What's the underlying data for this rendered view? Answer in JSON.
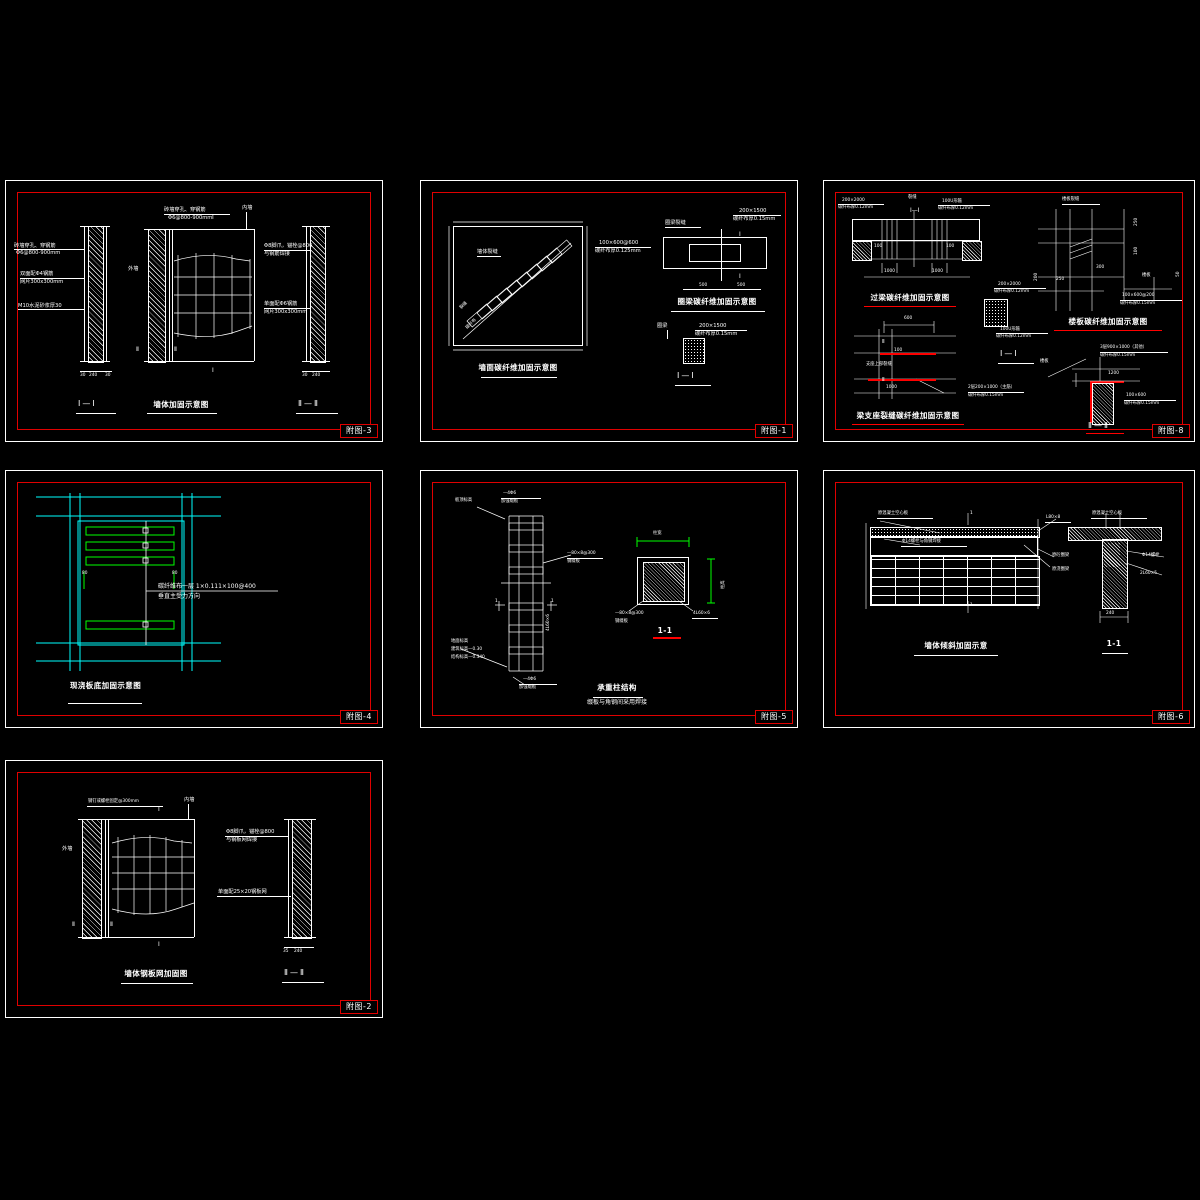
{
  "drawing": {
    "background": "#000000",
    "line_color": "#ffffff",
    "frame_color": "#ff0000",
    "accent_cyan": "#00ffff",
    "accent_green": "#00ff00"
  },
  "sheets": [
    {
      "id": "fig3",
      "title_block": "附图-3",
      "main_title": "墙体加固示意图",
      "labels": {
        "note_top_1": "砖墙穿孔、穿钢筋",
        "note_top_2": "Φ6@800-900mm",
        "left_note_1": "砖墙穿孔、穿钢筋",
        "left_note_2": "Φ6@800-900mm",
        "left_note_3": "双面配Φ4钢筋",
        "left_note_4": "网片300x300mm",
        "left_note_5": "M10水泥砂浆厚30",
        "right_note_1": "Φ8脚爪，锚栓@800",
        "right_note_2": "与钢筋焊接",
        "right_note_3": "单面配Φ6钢筋",
        "right_note_4": "网片300x300mm",
        "outer_wall": "外墙",
        "inner_wall": "内墙",
        "dim_left": "30",
        "dim_mid": "240",
        "dim_right": "30",
        "dim2_left": "30",
        "dim2_mid": "240",
        "section_1": "Ⅰ—Ⅰ",
        "section_2": "Ⅱ—Ⅱ",
        "mark_I": "Ⅰ",
        "mark_II": "Ⅱ"
      }
    },
    {
      "id": "fig1",
      "title_block": "附图-1",
      "main_title": "墙面碳纤维加固示意图",
      "sub_title": "圈梁碳纤维加固示意图",
      "labels": {
        "wall_crack": "墙体裂缝",
        "spec_1": "100×600@600",
        "spec_2": "碳纤布厚0.125mm",
        "ring_crack": "圈梁裂缝",
        "spec_3": "200×1500",
        "spec_4": "碳纤布厚0.15mm",
        "dim_500_a": "500",
        "dim_500_b": "500",
        "ring_beam": "圈梁",
        "spec_5": "200×1500",
        "spec_6": "碳纤布厚0.15mm",
        "section_1": "Ⅰ—Ⅰ",
        "mark_I": "Ⅰ",
        "crack_label_a": "裂缝",
        "crack_label_b": "碳纤布"
      }
    },
    {
      "id": "fig8",
      "title_block": "附图-8",
      "titles": {
        "t1": "过梁碳纤维加固示意图",
        "t2": "梁支座裂缝碳纤维加固示意图",
        "t3": "楼板碳纤维加固示意图",
        "sec_11": "Ⅰ—Ⅰ",
        "sec_22": "Ⅱ—Ⅱ"
      },
      "labels": {
        "a1": "200×2000",
        "a2": "碳纤布厚0.12mm",
        "a3": "裂缝",
        "a4": "100U形箍",
        "a5": "碳纤布厚0.12mm",
        "a6": "100",
        "a7": "100",
        "a8": "1000",
        "a9": "1000",
        "b1": "200×2000",
        "b2": "碳纤布厚0.12mm",
        "b3": "100U形箍",
        "b4": "碳纤布厚0.12mm",
        "c1": "600",
        "c2": "100",
        "c3": "支座上部裂缝",
        "c4": "1000",
        "c5": "2层200×1000（主筋）",
        "c6": "碳纤布厚0.15mm",
        "d1": "楼板裂缝",
        "d2": "250",
        "d3": "100",
        "d4": "200",
        "d5": "250",
        "d6": "300",
        "d7": "楼板",
        "d8": "50",
        "d9": "100×600@200",
        "d10": "碳纤布厚0.15mm",
        "e1": "楼板",
        "e2": "3层900×1000（其他）",
        "e3": "碳纤布厚0.15mm",
        "e4": "1200",
        "e5": "100×600",
        "e6": "碳纤布厚0.15mm"
      }
    },
    {
      "id": "fig4",
      "title_block": "附图-4",
      "main_title": "现浇板底加固示意图",
      "labels": {
        "note_1": "碳纤维布一层  1×0.111×100@400",
        "note_2": "垂直主受力方向",
        "dim_a": "80",
        "dim_b": "80"
      }
    },
    {
      "id": "fig5",
      "title_block": "附图-5",
      "main_title": "承重柱结构",
      "sub_title": "缀板与角钢间采用焊接",
      "section": "1-1",
      "labels": {
        "top_1": "板顶标高",
        "top_2": "—4Φ6",
        "top_3": "加强缀板",
        "mid_1": "—80×8@300",
        "mid_2": "钢缀板",
        "mid_3": "4L60×6",
        "bot_1": "地面标高",
        "bot_2": "建筑标高—0.30",
        "bot_3": "结构标高—0.340",
        "bot_4": "—4Φ6",
        "bot_5": "加强缀板",
        "sec_1": "柱宽",
        "sec_2": "柱高",
        "sec_3": "—80×8@300",
        "sec_4": "钢缀板",
        "sec_5": "4L60×6",
        "mark_1": "1"
      }
    },
    {
      "id": "fig6",
      "title_block": "附图-6",
      "main_title": "墙体倾斜加固示意",
      "section": "1-1",
      "labels": {
        "l1": "原混凝土空心板",
        "l2": "Φ14螺栓与角钢焊接",
        "l3": "L80×8",
        "l4": "原砼圈梁",
        "l5": "原浇圈梁",
        "r1": "原混凝土空心板",
        "r2": "Φ14螺栓",
        "r3": "2L60×5",
        "r4": "240",
        "mark_1": "1"
      }
    },
    {
      "id": "fig2",
      "title_block": "附图-2",
      "main_title": "墙体钢板网加固图",
      "labels": {
        "top_1": "钢钉或螺栓固定@300mm",
        "outer_wall": "外墙",
        "inner_wall": "内墙",
        "right_1": "Φ8脚爪，锚栓@800",
        "right_2": "与钢板网焊接",
        "right_3": "单面配25×20钢板网",
        "dim_left": "35",
        "dim_mid": "240",
        "section_2": "Ⅱ—Ⅱ",
        "mark_I": "Ⅰ",
        "mark_II": "Ⅱ"
      }
    }
  ]
}
